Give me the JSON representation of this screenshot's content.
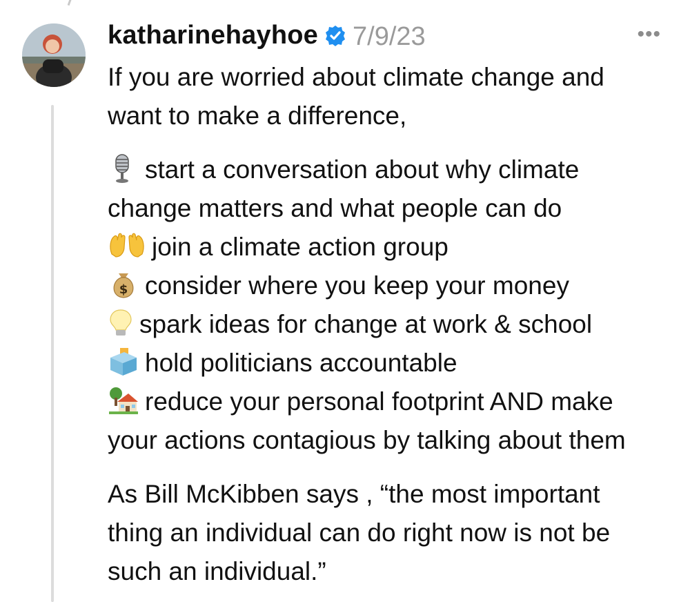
{
  "post": {
    "username": "katharinehayhoe",
    "date": "7/9/23",
    "more_label": "•••",
    "intro": [
      "If you are worried about climate change and",
      "want to make a difference,"
    ],
    "items": [
      {
        "icon": "microphone-icon",
        "lines": [
          "start a conversation about why climate",
          "change matters and what people can do"
        ]
      },
      {
        "icon": "raised-hands-icon",
        "lines": [
          "join a climate action group"
        ]
      },
      {
        "icon": "money-bag-icon",
        "lines": [
          "consider where you keep your money"
        ]
      },
      {
        "icon": "light-bulb-icon",
        "lines": [
          "spark ideas for change at work & school"
        ]
      },
      {
        "icon": "ballot-box-icon",
        "lines": [
          "hold politicians accountable"
        ]
      },
      {
        "icon": "house-with-garden-icon",
        "lines": [
          "reduce your personal footprint AND make",
          "your actions contagious by talking about them"
        ]
      }
    ],
    "quote": [
      "As Bill McKibben says , “the most important",
      "thing an individual can do right now is not be",
      "such an individual.”"
    ]
  }
}
